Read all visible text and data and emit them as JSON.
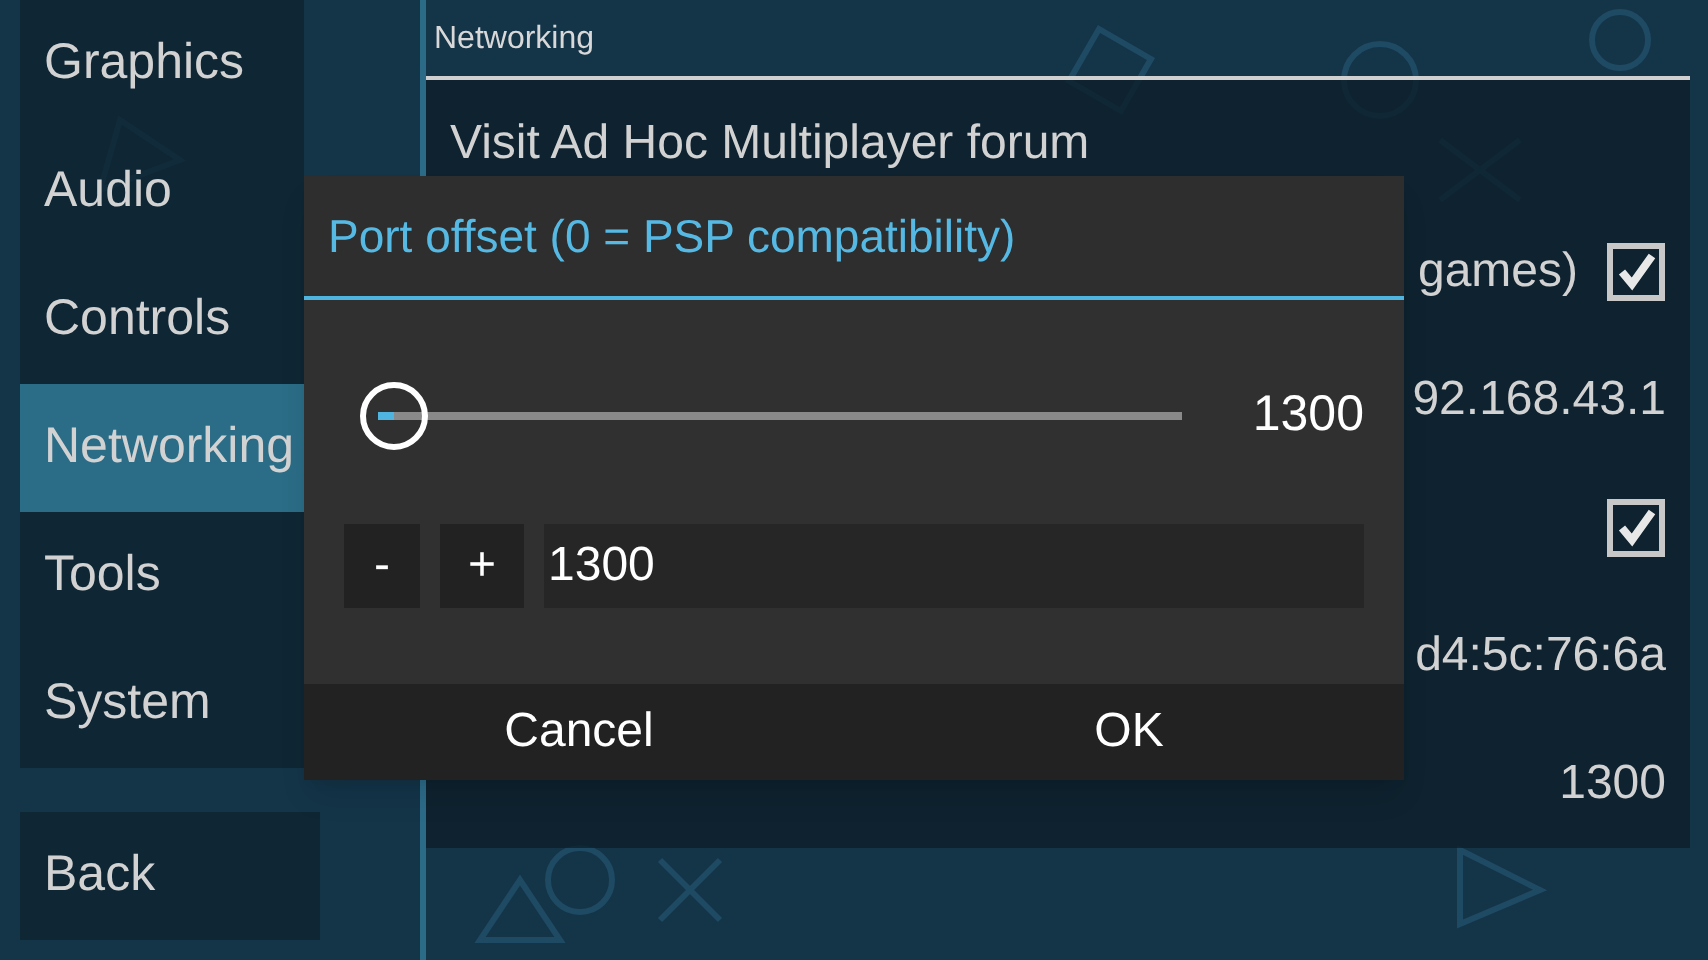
{
  "sidebar": {
    "items": [
      {
        "label": "Graphics",
        "selected": false
      },
      {
        "label": "Audio",
        "selected": false
      },
      {
        "label": "Controls",
        "selected": false
      },
      {
        "label": "Networking",
        "selected": true
      },
      {
        "label": "Tools",
        "selected": false
      },
      {
        "label": "System",
        "selected": false
      }
    ],
    "back": "Back"
  },
  "panel": {
    "header": "Networking",
    "rows": [
      {
        "kind": "link",
        "label": "Visit Ad Hoc Multiplayer forum"
      },
      {
        "kind": "checkbox",
        "label": "games)",
        "checked": true
      },
      {
        "kind": "value",
        "value": "92.168.43.1"
      },
      {
        "kind": "checkbox",
        "checked": true
      },
      {
        "kind": "value",
        "value": "d4:5c:76:6a"
      },
      {
        "kind": "value",
        "value": "1300"
      }
    ]
  },
  "dialog": {
    "title": "Port offset (0 = PSP compatibility)",
    "slider": {
      "level": 0.02,
      "reading": "1300"
    },
    "minus": "-",
    "plus": "+",
    "input": "1300",
    "buttons": [
      "Cancel",
      "OK"
    ]
  }
}
